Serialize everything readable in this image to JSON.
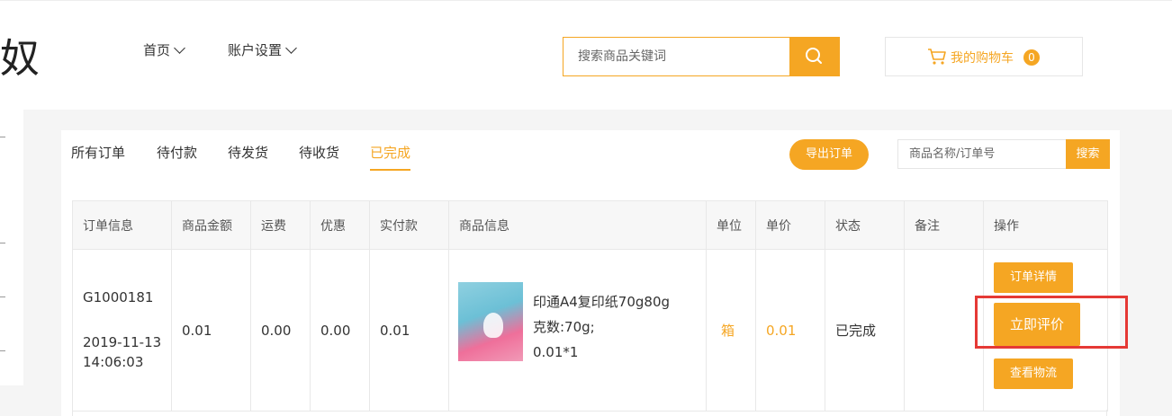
{
  "header": {
    "logo_text": "奴",
    "nav": [
      {
        "label": "首页"
      },
      {
        "label": "账户设置"
      }
    ],
    "search": {
      "placeholder": "搜索商品关键词"
    },
    "cart": {
      "label": "我的购物车",
      "count": "0"
    }
  },
  "orders": {
    "tabs": [
      "所有订单",
      "待付款",
      "待发货",
      "待收货",
      "已完成"
    ],
    "active_tab": "已完成",
    "export_label": "导出订单",
    "search_placeholder": "商品名称/订单号",
    "search_button": "搜索",
    "columns": [
      "订单信息",
      "商品金额",
      "运费",
      "优惠",
      "实付款",
      "商品信息",
      "单位",
      "单价",
      "状态",
      "备注",
      "操作"
    ],
    "rows": [
      {
        "order_no": "G1000181",
        "date": "2019-11-13",
        "time": "14:06:03",
        "goods_amount": "0.01",
        "freight": "0.00",
        "discount": "0.00",
        "paid": "0.01",
        "product_name": "印通A4复印纸70g80g",
        "product_spec": "克数:70g;",
        "product_qty": "0.01*1",
        "unit": "箱",
        "price": "0.01",
        "status": "已完成",
        "remark": "",
        "actions": {
          "detail": "订单详情",
          "review": "立即评价",
          "logistics": "查看物流"
        }
      }
    ]
  },
  "colors": {
    "accent": "#f5a623",
    "highlight": "#e53935"
  },
  "icons": [
    "search-icon",
    "cart-icon",
    "chevron-down-icon"
  ]
}
